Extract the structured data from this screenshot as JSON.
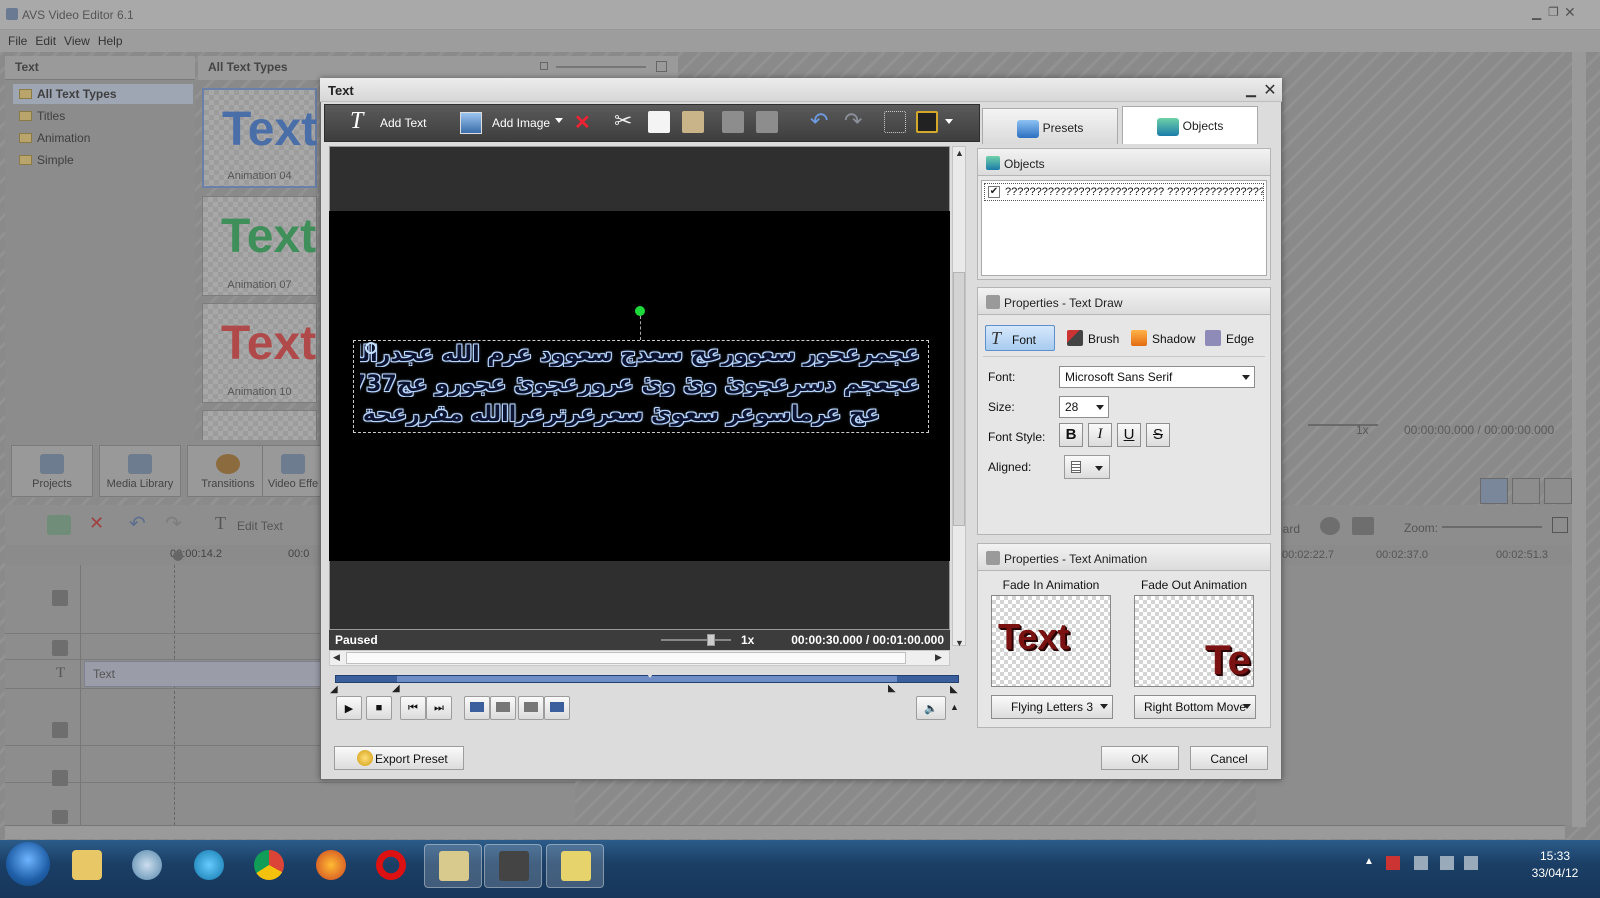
{
  "app": {
    "title": "AVS Video Editor 6.1",
    "menu": [
      "File",
      "Edit",
      "View",
      "Help"
    ]
  },
  "left_panel": {
    "header": "Text",
    "items": [
      "All Text Types",
      "Titles",
      "Animation",
      "Simple"
    ]
  },
  "gallery": {
    "header": "All Text Types",
    "thumbs": [
      {
        "label": "Animation 04",
        "glyph": "Text",
        "color": "#4a6ea8"
      },
      {
        "label": "Animation 07",
        "glyph": "Text",
        "color": "#3f8f5a"
      },
      {
        "label": "Animation 10",
        "glyph": "Text",
        "color": "#b04a4a"
      }
    ]
  },
  "tools": [
    "Projects",
    "Media Library",
    "Transitions",
    "Video Effe"
  ],
  "timeline": {
    "edit_text": "Edit Text",
    "ruler": [
      "00:00:14.2",
      "00:0"
    ],
    "clip_label": "Text",
    "right_ruler": [
      "00:02:22.7",
      "00:02:37.0",
      "00:02:51.3"
    ],
    "zoom_label": "Zoom:",
    "board_label": "bard"
  },
  "main_preview_status": {
    "rate": "1x",
    "time": "00:00:00.000 / 00:00:00.000"
  },
  "dialog": {
    "title": "Text",
    "toolbar": {
      "add_text": "Add Text",
      "add_image": "Add Image"
    },
    "tabs": {
      "presets": "Presets",
      "objects": "Objects"
    },
    "preview": {
      "lines": [
        "عجمرعحور سعوورعج سعدج سعوود عرم الله عجدرالله ع الله سبحس ۵",
        "عجعجم دسرعجوئ وئ وئ عرورعجوئ عجورو عج77737عسرحم",
        "عج عرماسوعر سعوئ سعرعرترعراالله مقررعحة سروعج"
      ]
    },
    "status": {
      "state": "Paused",
      "rate": "1x",
      "time": "00:00:30.000  /  00:01:00.000"
    },
    "export_preset": "Export Preset",
    "ok": "OK",
    "cancel": "Cancel"
  },
  "objects_panel": {
    "header": "Objects",
    "items": [
      {
        "checked": "✔",
        "text": "?????????????????????????? ????????????????????..."
      }
    ]
  },
  "text_draw": {
    "header": "Properties - Text Draw",
    "subtabs": [
      "Font",
      "Brush",
      "Shadow",
      "Edge"
    ],
    "font_label": "Font:",
    "font_value": "Microsoft Sans Serif",
    "size_label": "Size:",
    "size_value": "28",
    "style_label": "Font Style:",
    "styles": [
      "B",
      "I",
      "U",
      "S"
    ],
    "aligned_label": "Aligned:"
  },
  "text_animation": {
    "header": "Properties - Text Animation",
    "fade_in_label": "Fade In Animation",
    "fade_out_label": "Fade Out Animation",
    "fade_in_preview": "Text",
    "fade_out_preview": "Te",
    "fade_in_value": "Flying Letters 3",
    "fade_out_value": "Right Bottom Move"
  },
  "taskbar": {
    "time": "15:33",
    "date": "33/04/12"
  }
}
